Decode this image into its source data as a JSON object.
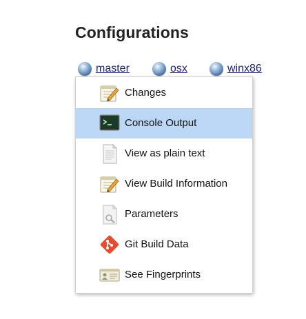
{
  "section": {
    "title": "Configurations"
  },
  "configurations": [
    {
      "label": "master"
    },
    {
      "label": "osx"
    },
    {
      "label": "winx86"
    }
  ],
  "menu": {
    "items": [
      {
        "label": "Changes",
        "icon": "notepad-pencil-icon"
      },
      {
        "label": "Console Output",
        "icon": "terminal-icon",
        "active": true
      },
      {
        "label": "View as plain text",
        "icon": "document-icon"
      },
      {
        "label": "View Build Information",
        "icon": "notepad-pencil-icon"
      },
      {
        "label": "Parameters",
        "icon": "document-wrench-icon"
      },
      {
        "label": "Git Build Data",
        "icon": "git-icon"
      },
      {
        "label": "See Fingerprints",
        "icon": "id-card-icon"
      }
    ]
  },
  "colors": {
    "highlight": "#bcd7f5",
    "link": "#1a1f6b",
    "git": "#e44d2e"
  }
}
